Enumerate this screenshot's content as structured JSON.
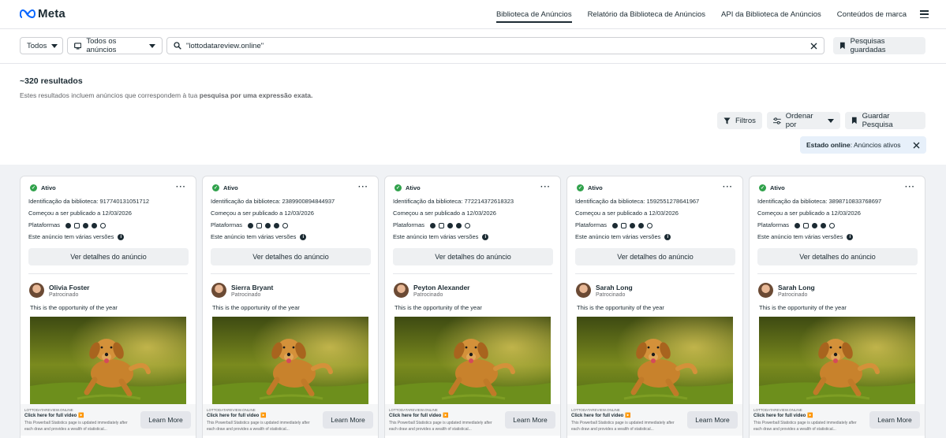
{
  "nav": {
    "brand": "Meta",
    "links": [
      "Biblioteca de Anúncios",
      "Relatório da Biblioteca de Anúncios",
      "API da Biblioteca de Anúncios",
      "Conteúdos de marca"
    ]
  },
  "search": {
    "country_select": "Todos",
    "ad_type_select": "Todos os anúncios",
    "query": "\"lottodatareview.online\"",
    "saved_searches": "Pesquisas guardadas"
  },
  "results": {
    "count": "~320 resultados",
    "note_prefix": "Estes resultados incluem anúncios que correspondem à tua ",
    "note_bold": "pesquisa por uma expressão exata."
  },
  "toolbar": {
    "filters": "Filtros",
    "sort": "Ordenar por",
    "save_search": "Guardar Pesquisa"
  },
  "filter_chip": {
    "label": "Estado online",
    "value": ": Anúncios ativos"
  },
  "card_labels": {
    "status": "Ativo",
    "library_id_prefix": "Identificação da biblioteca: ",
    "started": "Começou a ser publicado a 12/03/2026",
    "platforms": "Plataformas",
    "versions": "Este anúncio tem várias versões",
    "details_button": "Ver detalhes do anúncio",
    "sponsored": "Patrocinado",
    "ad_text": "This is the opportunity of the year",
    "footer_domain": "LOTTODATAREVIEW.ONLINE",
    "footer_title": "Click here for full video ▶️",
    "footer_desc": "This Powerball Statistics page is updated immediately after each draw and provides a wealth of statistical...",
    "cta": "Learn More"
  },
  "cards": [
    {
      "library_id": "917740131051712",
      "advertiser": "Olivia Foster"
    },
    {
      "library_id": "2389900894844937",
      "advertiser": "Sierra Bryant"
    },
    {
      "library_id": "772214372618323",
      "advertiser": "Peyton Alexander"
    },
    {
      "library_id": "1592551278641967",
      "advertiser": "Sarah Long"
    },
    {
      "library_id": "3898710833768697",
      "advertiser": "Sarah Long"
    }
  ],
  "colors": {
    "accent": "#0866ff",
    "status_green": "#31a24c",
    "page_bg": "#f0f2f5",
    "chip_bg": "#e7f0fa"
  }
}
